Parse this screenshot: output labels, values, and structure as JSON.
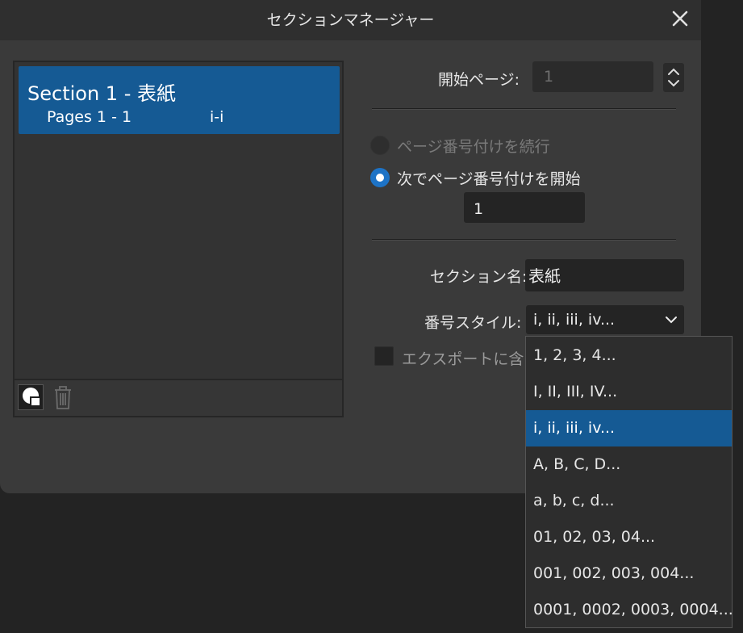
{
  "dialog": {
    "title": "セクションマネージャー"
  },
  "sections": [
    {
      "name": "Section 1 - 表紙",
      "pages": "Pages 1 - 1",
      "range": "i-i"
    }
  ],
  "start_page": {
    "label": "開始ページ:",
    "value": "1"
  },
  "numbering": {
    "continue_label": "ページ番号付けを続行",
    "start_at_label": "次でページ番号付けを開始",
    "start_at_value": "1"
  },
  "section_name": {
    "label": "セクション名:",
    "value": "表紙"
  },
  "number_style": {
    "label": "番号スタイル:",
    "value": "i, ii, iii, iv...",
    "options": [
      "1, 2, 3, 4...",
      "I, II, III, IV...",
      "i, ii, iii, iv...",
      "A, B, C, D...",
      "a, b, c, d...",
      "01, 02, 03, 04...",
      "001, 002, 003, 004...",
      "0001, 0002, 0003, 0004..."
    ],
    "selected_index": 2
  },
  "export": {
    "label": "エクスポートに含め"
  },
  "colors": {
    "accent": "#155a94",
    "radio_on": "#1d73c6",
    "dialog_bg": "#3a3a3a",
    "titlebar_bg": "#2f2f2f"
  },
  "icons": {
    "close": "close-icon",
    "add_section": "add-section-icon",
    "delete": "trash-icon",
    "spinner": "up-down-arrows-icon",
    "dropdown": "chevron-down-icon"
  }
}
